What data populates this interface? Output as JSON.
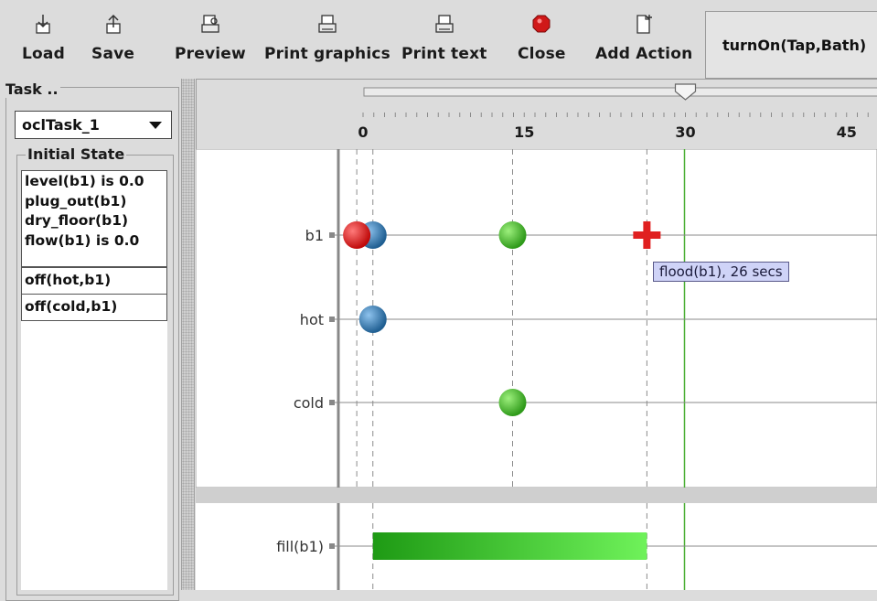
{
  "toolbar": {
    "buttons": [
      {
        "label": "Load",
        "icon": "load-icon"
      },
      {
        "label": "Save",
        "icon": "save-icon"
      },
      {
        "label": "Preview",
        "icon": "preview-icon"
      },
      {
        "label": "Print graphics",
        "icon": "printer-icon"
      },
      {
        "label": "Print text",
        "icon": "printer-icon"
      },
      {
        "label": "Close",
        "icon": "close-stop-icon"
      },
      {
        "label": "Add Action",
        "icon": "add-document-icon"
      }
    ],
    "action_name": "turnOn(Tap,Bath)"
  },
  "task": {
    "group_title": "Task ..",
    "selected": "oclTask_1"
  },
  "initial_state": {
    "title": "Initial State",
    "groups": [
      [
        "level(b1) is 0.0",
        "plug_out(b1)",
        "dry_floor(b1)",
        "flow(b1) is 0.0"
      ],
      [
        "off(hot,b1)"
      ],
      [
        "off(cold,b1)"
      ]
    ]
  },
  "timeline": {
    "tick_labels": [
      "0",
      "15",
      "30",
      "45"
    ],
    "slider_value": 30,
    "current_time": 30,
    "rows": [
      "b1",
      "hot",
      "cold"
    ],
    "duration_rows": [
      "fill(b1)"
    ],
    "events": [
      {
        "row": "b1",
        "time": -0.5,
        "color": "#e02020"
      },
      {
        "row": "b1",
        "time": 1,
        "color": "#3a86c4"
      },
      {
        "row": "b1",
        "time": 14,
        "color": "#3fbf2a"
      },
      {
        "row": "hot",
        "time": 1,
        "color": "#3a86c4"
      },
      {
        "row": "cold",
        "time": 14,
        "color": "#3fbf2a"
      }
    ],
    "marker": {
      "row": "b1",
      "time": 26.5,
      "color": "#e02020",
      "tooltip": "flood(b1), 26 secs"
    },
    "fill_bar": {
      "row": "fill(b1)",
      "start": 1,
      "end": 26.5,
      "color_start": "#1e9a14",
      "color_end": "#6ff25a"
    },
    "colors": {
      "accent_line": "#4caf35",
      "axis": "#666666"
    }
  }
}
